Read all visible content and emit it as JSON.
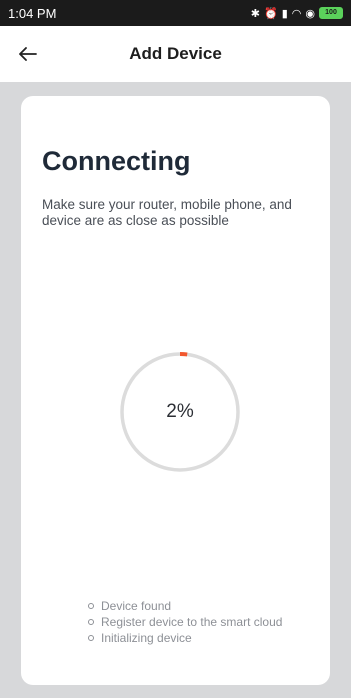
{
  "status_bar": {
    "time": "1:04 PM",
    "battery": "100",
    "icons": [
      "bluetooth-icon",
      "alarm-icon",
      "signal-icon",
      "wifi-icon",
      "data-saver-icon",
      "battery-icon"
    ]
  },
  "header": {
    "title": "Add Device",
    "back_icon": "arrow-left-icon"
  },
  "card": {
    "heading": "Connecting",
    "description": "Make sure your router, mobile phone, and device are as close as possible",
    "progress": {
      "percent": 2,
      "label": "2%",
      "track_color": "#dcdcdc",
      "fill_color": "#f1582f"
    },
    "steps": [
      "Device found",
      "Register device to the smart cloud",
      "Initializing device"
    ]
  }
}
